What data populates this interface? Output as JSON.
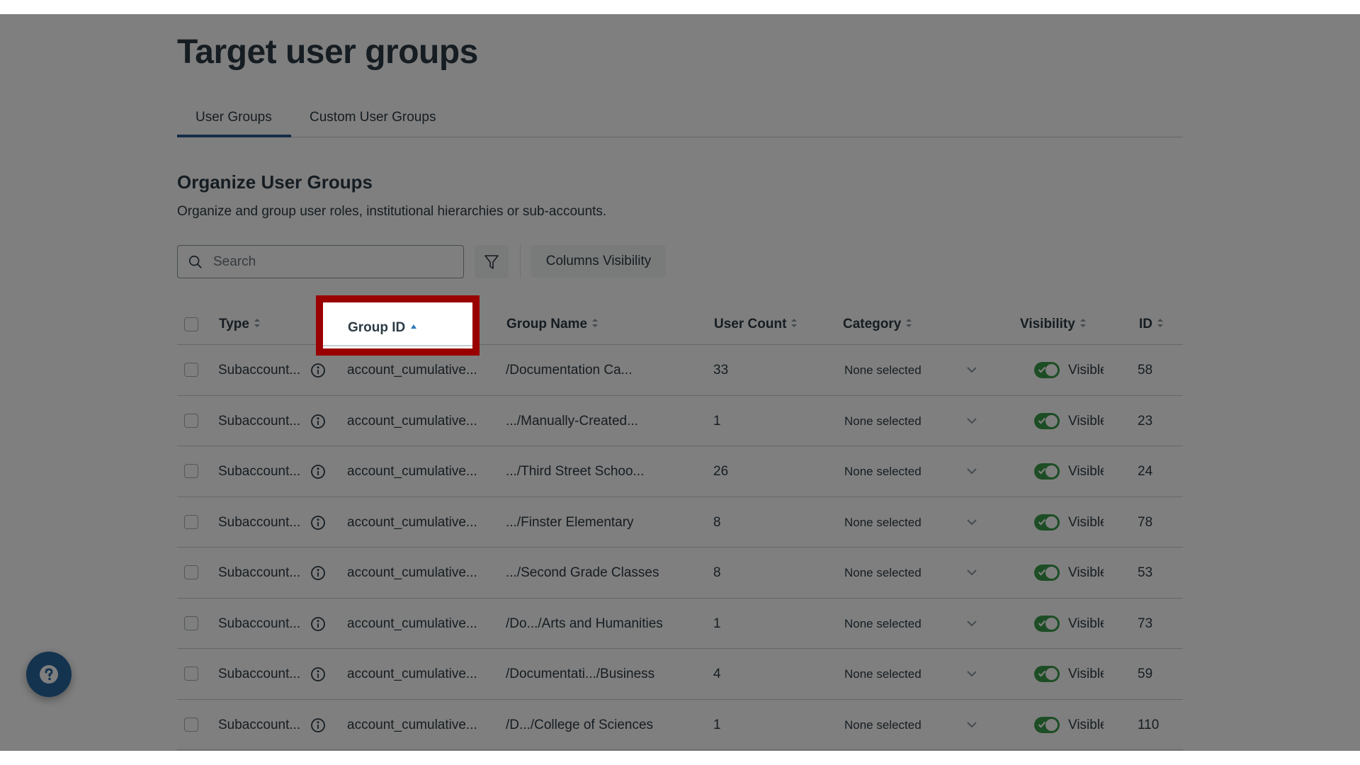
{
  "page": {
    "title": "Target user groups"
  },
  "tabs": [
    {
      "label": "User Groups",
      "active": true
    },
    {
      "label": "Custom User Groups",
      "active": false
    }
  ],
  "section": {
    "title": "Organize User Groups",
    "description": "Organize and group user roles, institutional hierarchies or sub-accounts."
  },
  "toolbar": {
    "search_placeholder": "Search",
    "search_value": "",
    "filter_icon": "filter-funnel-icon",
    "columns_visibility_label": "Columns Visibility"
  },
  "table": {
    "columns": [
      {
        "key": "select",
        "label": ""
      },
      {
        "key": "type",
        "label": "Type",
        "sort": "none"
      },
      {
        "key": "group_id",
        "label": "Group ID",
        "sort": "ascending"
      },
      {
        "key": "group_name",
        "label": "Group Name",
        "sort": "none"
      },
      {
        "key": "user_count",
        "label": "User Count",
        "sort": "none"
      },
      {
        "key": "category",
        "label": "Category",
        "sort": "none"
      },
      {
        "key": "visibility",
        "label": "Visibility",
        "sort": "none"
      },
      {
        "key": "id",
        "label": "ID",
        "sort": "none"
      }
    ],
    "rows": [
      {
        "type": "Subaccount...",
        "group_id": "account_cumulative...",
        "group_name": "/Documentation Ca...",
        "user_count": "33",
        "category": "None selected",
        "visibility": "Visible",
        "visible": true,
        "id": "58"
      },
      {
        "type": "Subaccount...",
        "group_id": "account_cumulative...",
        "group_name": ".../Manually-Created...",
        "user_count": "1",
        "category": "None selected",
        "visibility": "Visible",
        "visible": true,
        "id": "23"
      },
      {
        "type": "Subaccount...",
        "group_id": "account_cumulative...",
        "group_name": ".../Third Street Schoo...",
        "user_count": "26",
        "category": "None selected",
        "visibility": "Visible",
        "visible": true,
        "id": "24"
      },
      {
        "type": "Subaccount...",
        "group_id": "account_cumulative...",
        "group_name": ".../Finster Elementary",
        "user_count": "8",
        "category": "None selected",
        "visibility": "Visible",
        "visible": true,
        "id": "78"
      },
      {
        "type": "Subaccount...",
        "group_id": "account_cumulative...",
        "group_name": ".../Second Grade Classes",
        "user_count": "8",
        "category": "None selected",
        "visibility": "Visible",
        "visible": true,
        "id": "53"
      },
      {
        "type": "Subaccount...",
        "group_id": "account_cumulative...",
        "group_name": "/Do.../Arts and Humanities",
        "user_count": "1",
        "category": "None selected",
        "visibility": "Visible",
        "visible": true,
        "id": "73"
      },
      {
        "type": "Subaccount...",
        "group_id": "account_cumulative...",
        "group_name": "/Documentati.../Business",
        "user_count": "4",
        "category": "None selected",
        "visibility": "Visible",
        "visible": true,
        "id": "59"
      },
      {
        "type": "Subaccount...",
        "group_id": "account_cumulative...",
        "group_name": "/D.../College of Sciences",
        "user_count": "1",
        "category": "None selected",
        "visibility": "Visible",
        "visible": true,
        "id": "110"
      }
    ]
  },
  "help": {
    "icon": "help-question-icon"
  },
  "highlight": {
    "target": "Group ID column header",
    "color": "#990000"
  },
  "colors": {
    "accent": "#2b5a8f",
    "toggle_on": "#3b9a4a",
    "sort_active": "#2b7abc",
    "help_button": "#28679e",
    "overlay": "rgba(0,0,0,0.5)"
  }
}
